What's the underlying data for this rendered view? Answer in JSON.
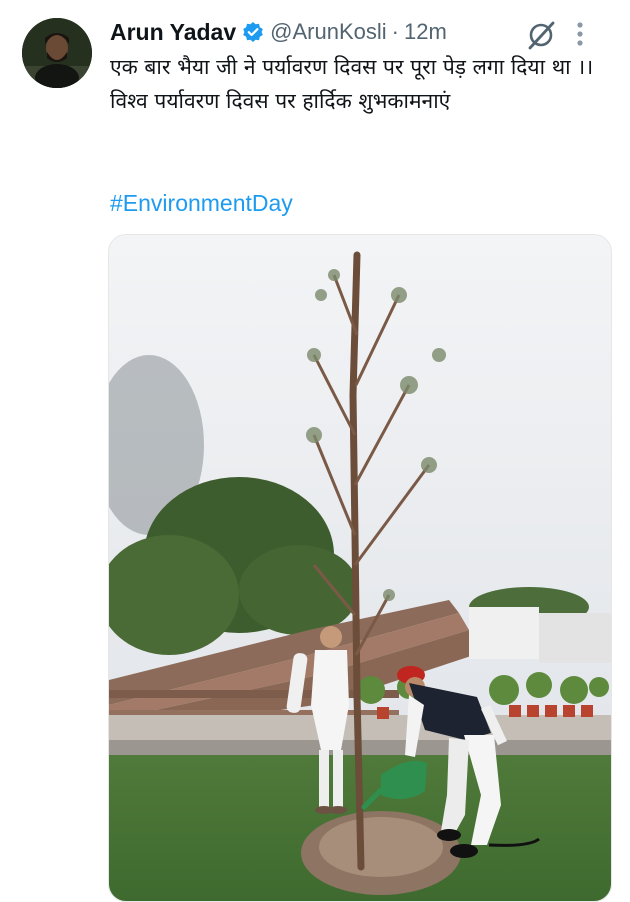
{
  "author": {
    "name": "Arun Yadav",
    "handle": "@ArunKosli",
    "separator": "·",
    "time": "12m",
    "verified": true,
    "verified_color": "#1d9bf0"
  },
  "tweet": {
    "line1": "एक बार भैया जी ने पर्यावरण दिवस पर पूरा पेड़ लगा दिया था ।।",
    "line2": "विश्व पर्यावरण दिवस पर हार्दिक शुभकामनाएं",
    "hashtag": "#EnvironmentDay",
    "hashtag_color": "#1d9bf0"
  },
  "icons": {
    "verified": "verified-badge-icon",
    "grok": "grok-icon",
    "more": "more-options-icon"
  },
  "media": {
    "type": "photo"
  }
}
